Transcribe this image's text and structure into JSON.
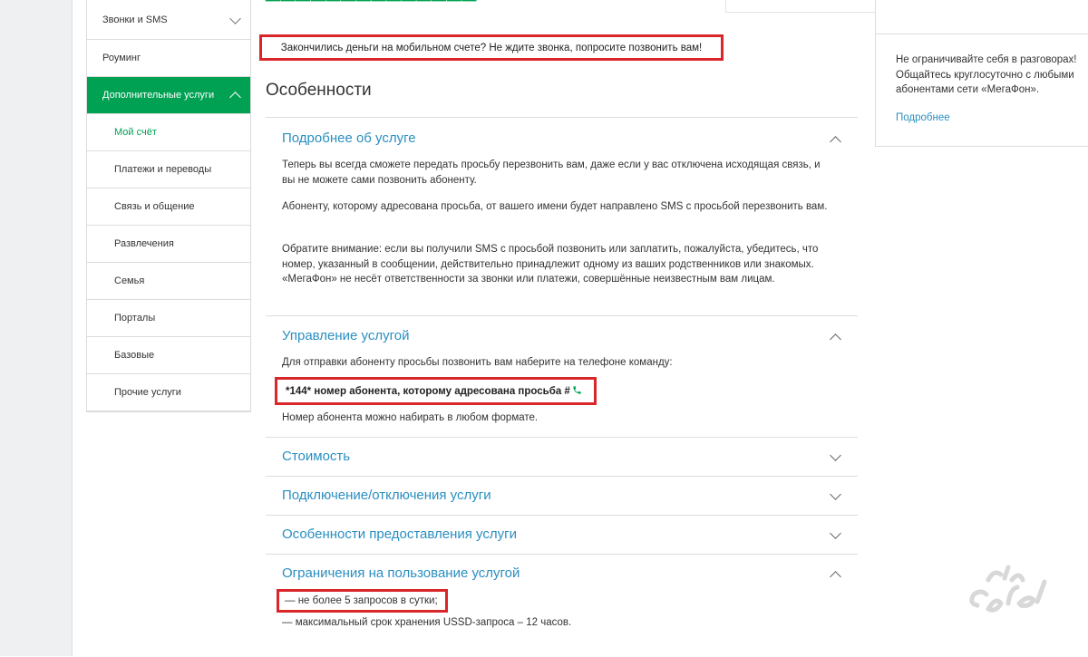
{
  "sidebar": {
    "items": [
      {
        "label": "Звонки и SMS"
      },
      {
        "label": "Роуминг"
      },
      {
        "label": "Дополнительные услуги"
      },
      {
        "label": "Мой счёт"
      },
      {
        "label": "Платежи и переводы"
      },
      {
        "label": "Связь и общение"
      },
      {
        "label": "Развлечения"
      },
      {
        "label": "Семья"
      },
      {
        "label": "Порталы"
      },
      {
        "label": "Базовые"
      },
      {
        "label": "Прочие услуги"
      }
    ]
  },
  "main": {
    "notice": "Закончились деньги на мобильном счете? Не ждите звонка, попросите позвонить вам!",
    "section_title": "Особенности",
    "accordion": [
      {
        "title": "Подробнее об услуге",
        "expanded": true,
        "paragraphs": [
          "Теперь вы всегда сможете передать просьбу перезвонить вам, даже если у вас отключена исходящая связь, и вы не можете сами позвонить абоненту.",
          "Абоненту, которому адресована просьба, от вашего имени будет направлено SMS с просьбой перезвонить вам.",
          "Обратите внимание: если вы получили SMS с просьбой позвонить или заплатить, пожалуйста, убедитесь, что номер, указанный в сообщении, действительно принадлежит одному из ваших родственников или знакомых. «МегаФон» не несёт ответственности за звонки или платежи, совершённые неизвестным вам лицам."
        ]
      },
      {
        "title": "Управление услугой",
        "expanded": true,
        "intro": "Для отправки абоненту просьбы позвонить вам наберите на телефоне команду:",
        "command": "*144* номер абонента, которому адресована просьба #",
        "note": "Номер абонента можно набирать в любом формате."
      },
      {
        "title": "Стоимость",
        "expanded": false
      },
      {
        "title": "Подключение/отключения услуги",
        "expanded": false
      },
      {
        "title": "Особенности предоставления услуги",
        "expanded": false
      },
      {
        "title": "Ограничения на пользование услугой",
        "expanded": true,
        "items": [
          "— не более 5 запросов в сутки;",
          "— максимальный срок хранения USSD-запроса – 12 часов."
        ]
      }
    ]
  },
  "promo": {
    "lines": [
      "Не ограничивайте себя в разговорах!",
      "Общайтесь круглосуточно с любыми",
      "абонентами сети «МегаФон»."
    ],
    "link": "Подробнее"
  },
  "colors": {
    "accent_green": "#00a153",
    "link_blue": "#2a8fc1",
    "highlight_red": "#d9262b"
  }
}
